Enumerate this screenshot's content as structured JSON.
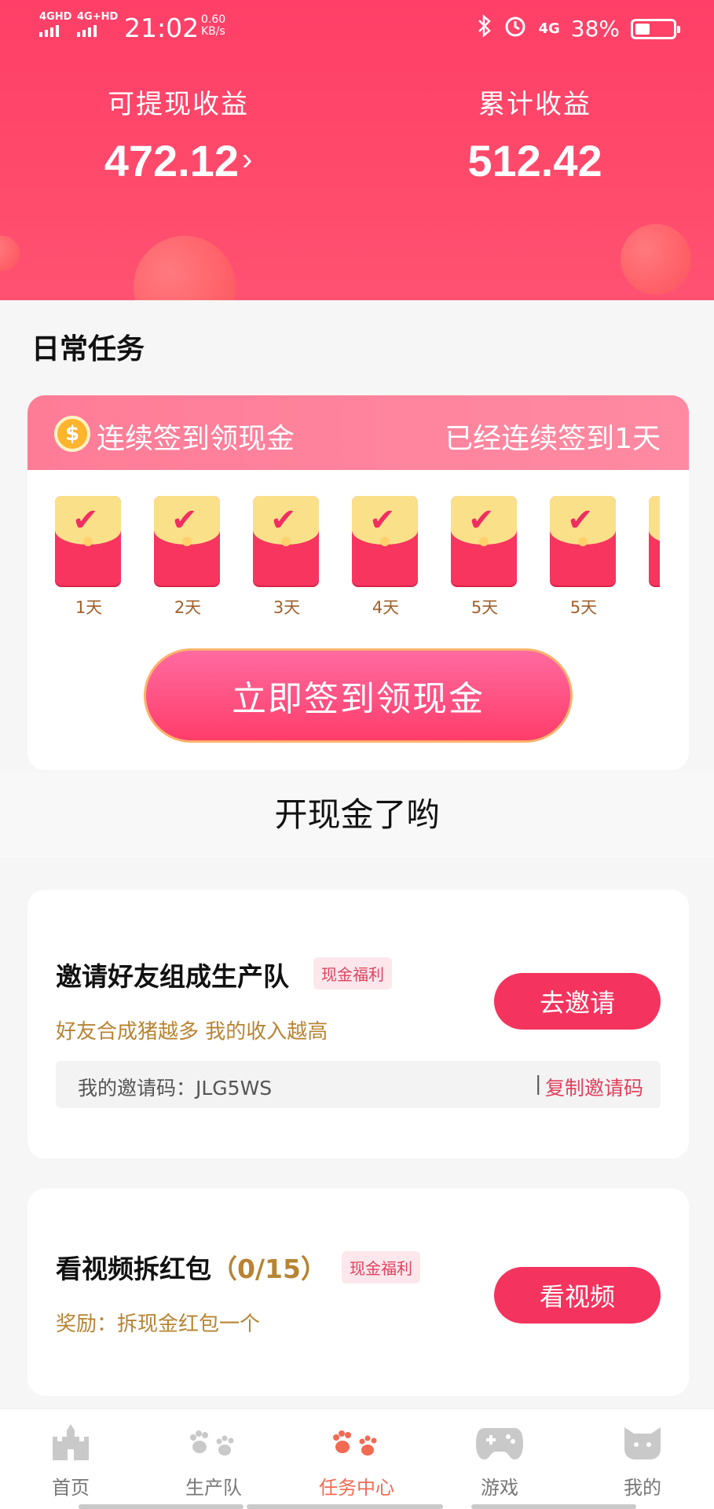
{
  "status_bar": {
    "net1": "4GHD",
    "net2": "4G+HD",
    "time": "21:02",
    "speed_value": "0.60",
    "speed_unit": "KB/s",
    "net3": "4G",
    "battery": "38%",
    "battery_level": 0.38
  },
  "earnings": {
    "withdrawable_label": "可提现收益",
    "withdrawable_value": "472.12",
    "withdrawable_arrow": "›",
    "total_label": "累计收益",
    "total_value": "512.42"
  },
  "daily": {
    "section_title": "日常任务",
    "coin_symbol": "$",
    "signin_title": "连续签到领现金",
    "signin_status": "已经连续签到1天",
    "days": [
      "1天",
      "2天",
      "3天",
      "4天",
      "5天",
      "5天"
    ],
    "check_mark": "✔",
    "sign_button": "立即签到领现金"
  },
  "banner": "开现金了哟",
  "invite_task": {
    "title": "邀请好友组成生产队",
    "tag": "现金福利",
    "subtitle": "好友合成猪越多 我的收入越高",
    "button": "去邀请",
    "code_text": "我的邀请码：JLG5WS",
    "separator": "|",
    "copy_label": "复制邀请码"
  },
  "video_task": {
    "title": "看视频拆红包",
    "count": "（0/15）",
    "tag": "现金福利",
    "subtitle": "奖励：拆现金红包一个",
    "button": "看视频"
  },
  "nav": {
    "items": [
      "首页",
      "生产队",
      "任务中心",
      "游戏",
      "我的"
    ],
    "active": "任务中心"
  },
  "colors": {
    "header": "#ff4a6b",
    "accent": "#f4345e",
    "gold_text": "#b78433",
    "nav_active": "#f26a52"
  }
}
